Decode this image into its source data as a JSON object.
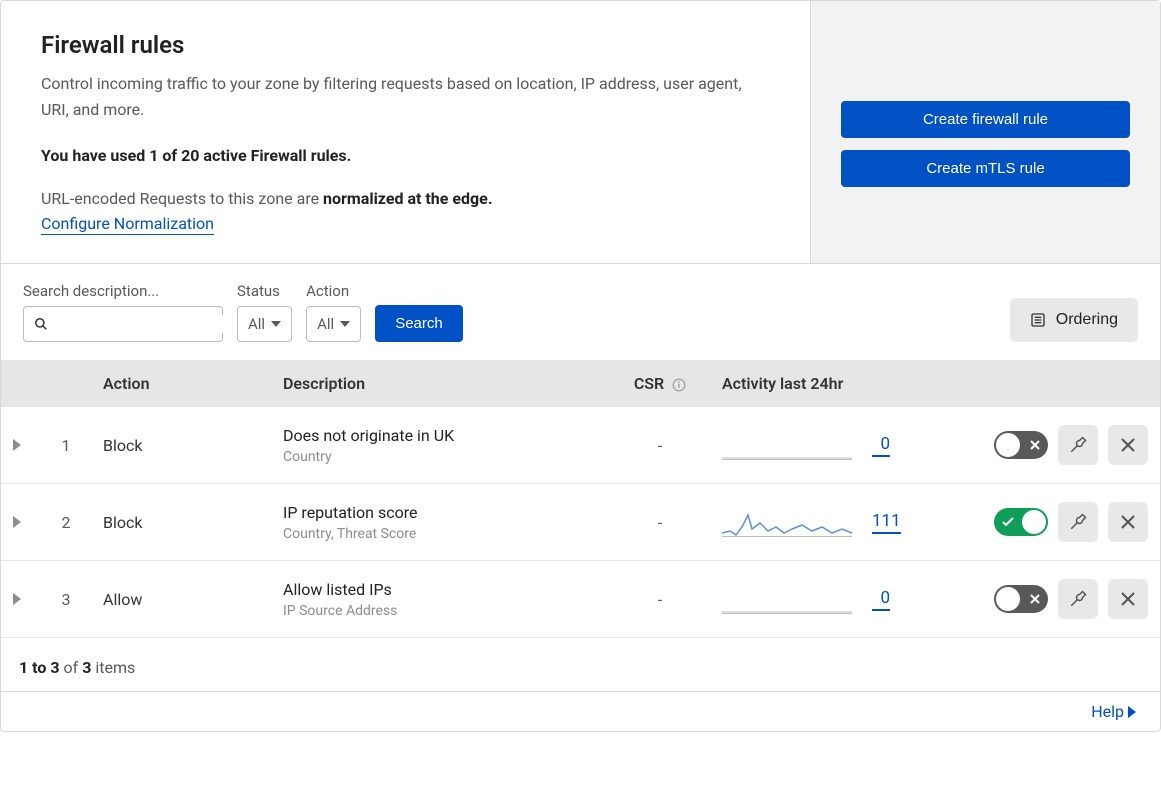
{
  "header": {
    "title": "Firewall rules",
    "description": "Control incoming traffic to your zone by filtering requests based on location, IP address, user agent, URI, and more.",
    "usage_prefix": "You have used ",
    "usage_count": "1 of 20",
    "usage_suffix": " active Firewall rules.",
    "normalize_prefix": "URL-encoded Requests to this zone are ",
    "normalize_bold": "normalized at the edge.",
    "configure_link": "Configure Normalization"
  },
  "actions": {
    "create_firewall": "Create firewall rule",
    "create_mtls": "Create mTLS rule"
  },
  "filters": {
    "search_label": "Search description...",
    "status_label": "Status",
    "status_value": "All",
    "action_label": "Action",
    "action_value": "All",
    "search_button": "Search",
    "ordering_button": "Ordering"
  },
  "table": {
    "headers": {
      "action": "Action",
      "description": "Description",
      "csr": "CSR",
      "activity": "Activity last 24hr"
    },
    "rows": [
      {
        "index": "1",
        "action": "Block",
        "title": "Does not originate in UK",
        "sub": "Country",
        "csr": "-",
        "count": "0",
        "enabled": false,
        "spark": "flat"
      },
      {
        "index": "2",
        "action": "Block",
        "title": "IP reputation score",
        "sub": "Country, Threat Score",
        "csr": "-",
        "count": "111",
        "enabled": true,
        "spark": "wave"
      },
      {
        "index": "3",
        "action": "Allow",
        "title": "Allow listed IPs",
        "sub": "IP Source Address",
        "csr": "-",
        "count": "0",
        "enabled": false,
        "spark": "flat"
      }
    ]
  },
  "pager": {
    "range_bold": "1 to 3",
    "of": " of ",
    "total_bold": "3",
    "items": " items"
  },
  "help": "Help"
}
